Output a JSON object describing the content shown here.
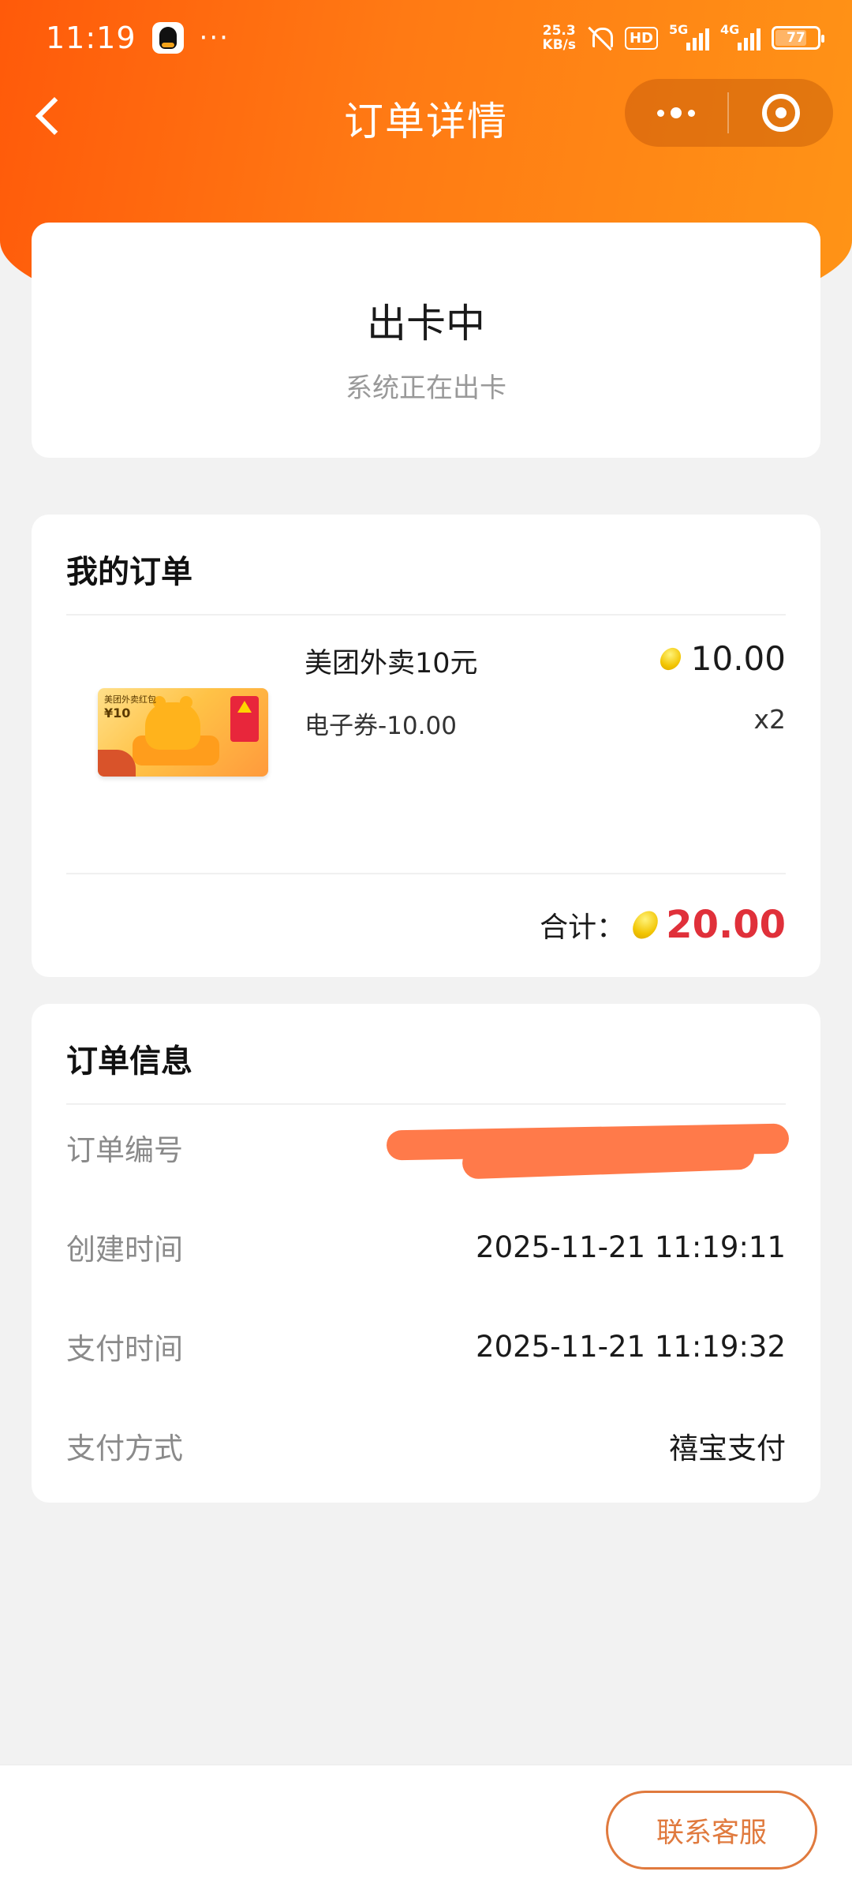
{
  "status_bar": {
    "time": "11:19",
    "dots": "···",
    "speed_value": "25.3",
    "speed_unit": "KB/s",
    "hd_badge": "HD",
    "signal_5g": "5G",
    "signal_4g": "4G",
    "battery": "77"
  },
  "nav": {
    "title": "订单详情"
  },
  "order_status": {
    "title": "出卡中",
    "subtitle": "系统正在出卡"
  },
  "my_order": {
    "section_title": "我的订单",
    "product": {
      "thumb_tag": "美团外卖红包",
      "thumb_price": "¥10",
      "name": "美团外卖10元",
      "spec": "电子券-10.00",
      "price": "10.00",
      "quantity": "x2"
    },
    "total_label": "合计：",
    "total_value": "20.00"
  },
  "order_info": {
    "section_title": "订单信息",
    "rows": [
      {
        "label": "订单编号",
        "value": ""
      },
      {
        "label": "创建时间",
        "value": "2025-11-21 11:19:11"
      },
      {
        "label": "支付时间",
        "value": "2025-11-21 11:19:32"
      },
      {
        "label": "支付方式",
        "value": "禧宝支付"
      }
    ]
  },
  "bottom": {
    "contact_button": "联系客服"
  },
  "colors": {
    "brand_orange": "#ff6a10",
    "price_red": "#e0303a",
    "button_outline": "#e07a3e",
    "redaction": "#ff7a4a"
  }
}
